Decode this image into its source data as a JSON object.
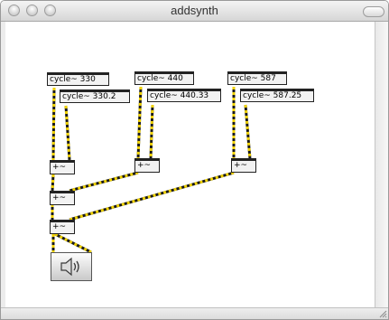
{
  "window": {
    "title": "addsynth"
  },
  "objects": {
    "cycle_1": "cycle~ 330",
    "cycle_2": "cycle~ 330.2",
    "cycle_3": "cycle~ 440",
    "cycle_4": "cycle~ 440.33",
    "cycle_5": "cycle~ 587",
    "cycle_6": "cycle~ 587.25",
    "plus_1": "+~",
    "plus_2": "+~",
    "plus_3": "+~",
    "plus_4": "+~",
    "plus_5": "+~"
  },
  "icons": {
    "dac": "speaker-icon"
  }
}
